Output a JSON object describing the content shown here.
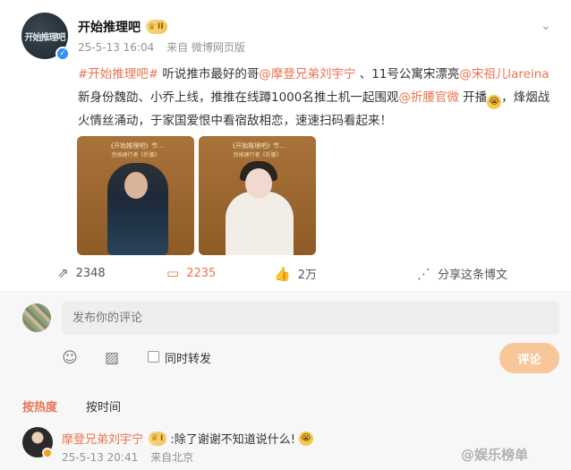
{
  "post": {
    "user_name": "开始推理吧",
    "avatar_text": "开始推理吧",
    "vip_level": "II",
    "time": "25-5-13 16:04",
    "source": "来自 微博网页版",
    "text_segments": [
      {
        "text": "#开始推理吧#",
        "link": true
      },
      {
        "text": " 听说推市最好的哥",
        "link": false
      },
      {
        "text": "@摩登兄弟刘宇宁",
        "link": true
      },
      {
        "text": " 、11号公寓宋漂亮",
        "link": false
      },
      {
        "text": "@宋祖儿lareina",
        "link": true
      },
      {
        "text": " 新身份魏劭、小乔上线，推推在线蹲1000名推土机一起围观",
        "link": false
      },
      {
        "text": "@折腰官微",
        "link": true
      },
      {
        "text": " 开播",
        "link": false
      },
      {
        "text": "，烽烟战火情丝涌动，于家国爱恨中看宿敌相恋，速速扫码看起来！",
        "link": false
      }
    ],
    "images": [
      {
        "title": "《开始推理吧》节...",
        "subtitle": "宫格建行者《折腰》"
      },
      {
        "title": "《开始推理吧》节...",
        "subtitle": "宫格建行者《折腰》"
      }
    ],
    "actions": {
      "repost_count": "2348",
      "comment_count": "2235",
      "like_count": "2万",
      "share_label": "分享这条博文"
    }
  },
  "comment_box": {
    "placeholder": "发布你的评论",
    "repost_label": "同时转发",
    "submit_label": "评论"
  },
  "sort": {
    "hot_label": "按热度",
    "time_label": "按时间"
  },
  "comments": [
    {
      "user_name": "摩登兄弟刘宇宁",
      "vip_level": "I",
      "text": ":除了谢谢不知道说什么!",
      "time": "25-5-13 20:41",
      "location": "来自北京"
    }
  ],
  "watermark": "@娱乐榜单",
  "colors": {
    "accent": "#eb7350",
    "link": "#eb7350",
    "submit_button": "#f7c79a",
    "verified": "#2f8ff7"
  },
  "icons": [
    "verified-icon",
    "vip-crown-icon",
    "chevron-down-icon",
    "repost-icon",
    "comment-icon",
    "like-icon",
    "share-icon",
    "emoji-icon",
    "image-icon"
  ]
}
